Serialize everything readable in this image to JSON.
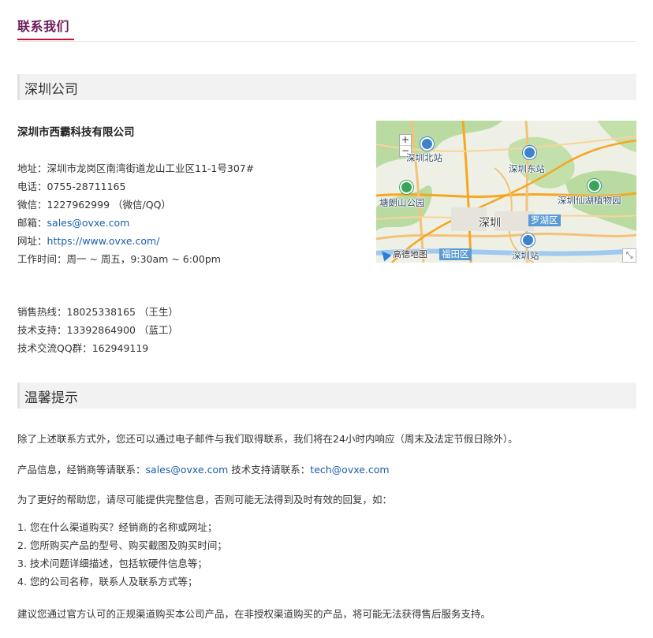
{
  "page": {
    "title": "联系我们"
  },
  "office": {
    "section_title": "深圳公司",
    "company_name": "深圳市西霸科技有限公司",
    "address_label": "地址：",
    "address": "深圳市龙岗区南湾街道龙山工业区11-1号307#",
    "phone_label": "电话：",
    "phone": "0755-28711165",
    "wechat_label": "微信：",
    "wechat": "1227962999 （微信/QQ）",
    "email_label": "邮箱：",
    "email": "sales@ovxe.com",
    "website_label": "网址：",
    "website": "https://www.ovxe.com/",
    "hours_label": "工作时间：",
    "hours": "周一 ~ 周五，9:30am ~ 6:00pm"
  },
  "contacts": {
    "sales_label": "销售热线：",
    "sales": "18025338165 （王生）",
    "support_label": "技术支持：",
    "support": "13392864900 （蓝工）",
    "qq_label": "技术交流QQ群：",
    "qq": "162949119"
  },
  "map": {
    "zoom_in": "+",
    "zoom_out": "−",
    "labels": {
      "north_station": "深圳北站",
      "east_station": "深圳东站",
      "tanglang": "塘朗山公园",
      "xianhu": "深圳仙湖植物园",
      "city": "深圳",
      "luohu": "罗湖区",
      "futian": "福田区",
      "shenzhen_station": "深圳站",
      "provider": "高德地图"
    },
    "expand": "⤡"
  },
  "tips": {
    "section_title": "温馨提示",
    "intro": "除了上述联系方式外，您还可以通过电子邮件与我们取得联系，我们将在24小时内响应（周末及法定节假日除外）。",
    "product_label": "产品信息，经销商等请联系：",
    "product_email": "sales@ovxe.com",
    "tech_label": "技术支持请联系：",
    "tech_email": "tech@ovxe.com",
    "help_text": "为了更好的帮助您，请尽可能提供完整信息，否则可能无法得到及时有效的回复，如：",
    "items": [
      "1. 您在什么渠道购买？经销商的名称或网址；",
      "2. 您所购买产品的型号、购买截图及购买时间；",
      "3. 技术问题详细描述，包括软硬件信息等；",
      "4. 您的公司名称，联系人及联系方式等；"
    ],
    "closing": "建议您通过官方认可的正规渠道购买本公司产品，在非授权渠道购买的产品，将可能无法获得售后服务支持。"
  }
}
